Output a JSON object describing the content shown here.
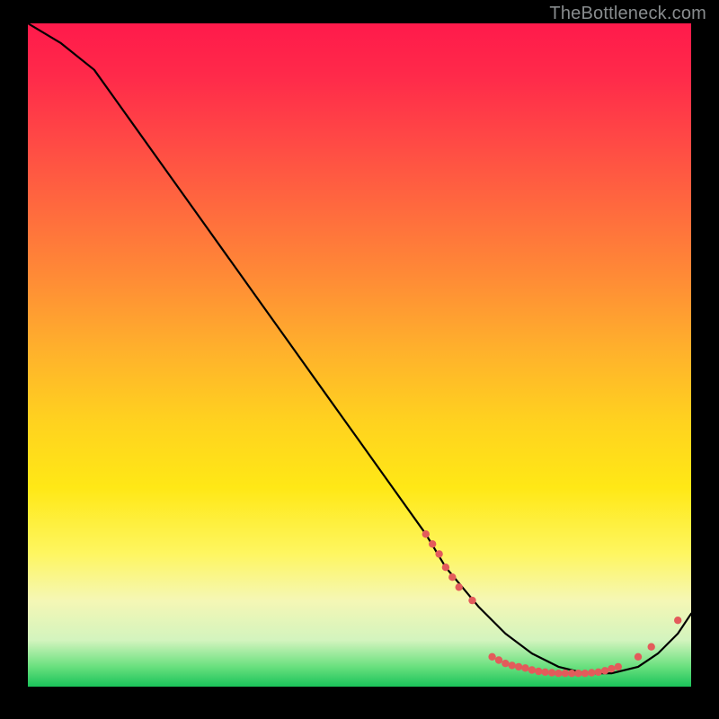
{
  "watermark": "TheBottleneck.com",
  "chart_data": {
    "type": "line",
    "title": "",
    "xlabel": "",
    "ylabel": "",
    "xlim": [
      0,
      100
    ],
    "ylim": [
      0,
      100
    ],
    "grid": false,
    "legend": false,
    "series": [
      {
        "name": "bottleneck-curve",
        "x": [
          0,
          5,
          10,
          15,
          20,
          25,
          30,
          35,
          40,
          45,
          50,
          55,
          60,
          63,
          68,
          72,
          76,
          80,
          84,
          88,
          92,
          95,
          98,
          100
        ],
        "y": [
          100,
          97,
          93,
          86,
          79,
          72,
          65,
          58,
          51,
          44,
          37,
          30,
          23,
          18,
          12,
          8,
          5,
          3,
          2,
          2,
          3,
          5,
          8,
          11
        ]
      }
    ],
    "marker_clusters": [
      {
        "name": "descending-tail-markers",
        "points": [
          {
            "x": 60,
            "y": 23
          },
          {
            "x": 61,
            "y": 21.5
          },
          {
            "x": 62,
            "y": 20
          },
          {
            "x": 63,
            "y": 18
          },
          {
            "x": 64,
            "y": 16.5
          },
          {
            "x": 65,
            "y": 15
          },
          {
            "x": 67,
            "y": 13
          }
        ]
      },
      {
        "name": "valley-floor-markers",
        "points": [
          {
            "x": 70,
            "y": 4.5
          },
          {
            "x": 71,
            "y": 4
          },
          {
            "x": 72,
            "y": 3.5
          },
          {
            "x": 73,
            "y": 3.2
          },
          {
            "x": 74,
            "y": 3
          },
          {
            "x": 75,
            "y": 2.8
          },
          {
            "x": 76,
            "y": 2.5
          },
          {
            "x": 77,
            "y": 2.3
          },
          {
            "x": 78,
            "y": 2.2
          },
          {
            "x": 79,
            "y": 2.1
          },
          {
            "x": 80,
            "y": 2
          },
          {
            "x": 81,
            "y": 2
          },
          {
            "x": 82,
            "y": 2
          },
          {
            "x": 83,
            "y": 2
          },
          {
            "x": 84,
            "y": 2
          },
          {
            "x": 85,
            "y": 2.1
          },
          {
            "x": 86,
            "y": 2.2
          },
          {
            "x": 87,
            "y": 2.4
          },
          {
            "x": 88,
            "y": 2.7
          },
          {
            "x": 89,
            "y": 3
          }
        ]
      },
      {
        "name": "rising-tail-markers",
        "points": [
          {
            "x": 92,
            "y": 4.5
          },
          {
            "x": 94,
            "y": 6
          },
          {
            "x": 98,
            "y": 10
          }
        ]
      }
    ],
    "colors": {
      "curve": "#000000",
      "markers": "#e35b5b",
      "gradient_top": "#ff1a4b",
      "gradient_bottom": "#1ac35a"
    }
  }
}
